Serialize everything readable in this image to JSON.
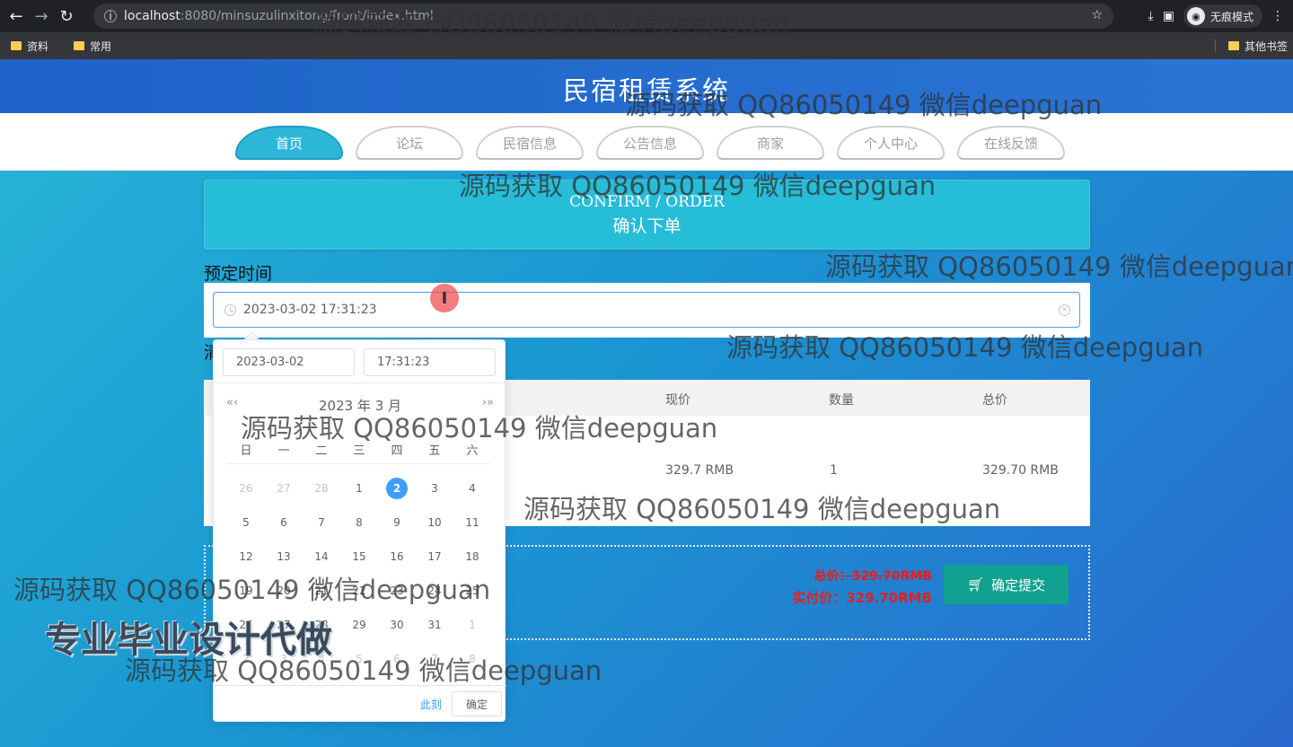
{
  "browser": {
    "url_host": "localhost",
    "url_rest": ":8080/minsuzulinxitong/front/index.html",
    "incognito_label": "无痕模式",
    "bookmarks": [
      "资料",
      "常用"
    ],
    "bookmark_other": "其他书签"
  },
  "site": {
    "title": "民宿租赁系统",
    "nav": [
      "首页",
      "论坛",
      "民宿信息",
      "公告信息",
      "商家",
      "个人中心",
      "在线反馈"
    ]
  },
  "confirm": {
    "title_en": "CONFIRM / ORDER",
    "title_zh": "确认下单"
  },
  "booking": {
    "label": "预定时间",
    "value": "2023-03-02 17:31:23",
    "second_label": "清"
  },
  "table": {
    "headers": [
      "现价",
      "数量",
      "总价"
    ],
    "row": [
      "329.7 RMB",
      "1",
      "329.70 RMB"
    ]
  },
  "totals": {
    "total_label": "总价：329.70RMB",
    "pay_label": "实付价：329.70RMB",
    "submit": "确定提交"
  },
  "picker": {
    "date_input": "2023-03-02",
    "time_input": "17:31:23",
    "prev": "«‹",
    "next": "›»",
    "title": "2023 年  3 月",
    "weekdays": [
      "日",
      "一",
      "二",
      "三",
      "四",
      "五",
      "六"
    ],
    "days": [
      {
        "d": "26",
        "muted": true
      },
      {
        "d": "27",
        "muted": true
      },
      {
        "d": "28",
        "muted": true
      },
      {
        "d": "1"
      },
      {
        "d": "2",
        "today": true
      },
      {
        "d": "3"
      },
      {
        "d": "4"
      },
      {
        "d": "5"
      },
      {
        "d": "6"
      },
      {
        "d": "7"
      },
      {
        "d": "8"
      },
      {
        "d": "9"
      },
      {
        "d": "10"
      },
      {
        "d": "11"
      },
      {
        "d": "12"
      },
      {
        "d": "13"
      },
      {
        "d": "14"
      },
      {
        "d": "15"
      },
      {
        "d": "16"
      },
      {
        "d": "17"
      },
      {
        "d": "18"
      },
      {
        "d": "19"
      },
      {
        "d": "20"
      },
      {
        "d": "21"
      },
      {
        "d": "22"
      },
      {
        "d": "23"
      },
      {
        "d": "24"
      },
      {
        "d": "25"
      },
      {
        "d": "26"
      },
      {
        "d": "27"
      },
      {
        "d": "28"
      },
      {
        "d": "29"
      },
      {
        "d": "30"
      },
      {
        "d": "31"
      },
      {
        "d": "1",
        "muted": true
      },
      {
        "d": "2",
        "muted": true
      },
      {
        "d": "3",
        "muted": true
      },
      {
        "d": "4",
        "muted": true
      },
      {
        "d": "5",
        "muted": true
      },
      {
        "d": "6",
        "muted": true
      },
      {
        "d": "7",
        "muted": true
      },
      {
        "d": "8",
        "muted": true
      }
    ],
    "now": "此刻",
    "ok": "确定"
  },
  "watermark": "源码获取 QQ86050149 微信deepguan",
  "promo": "专业毕业设计代做"
}
